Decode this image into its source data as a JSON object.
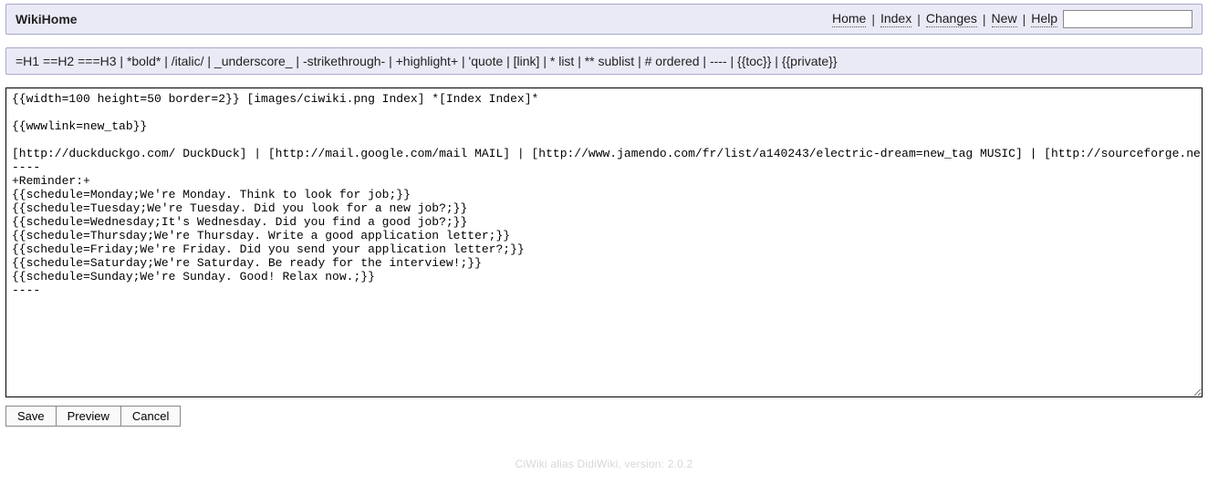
{
  "header": {
    "title": "WikiHome",
    "nav": {
      "home": "Home",
      "index": "Index",
      "changes": "Changes",
      "new": "New",
      "help": "Help"
    },
    "search_value": ""
  },
  "syntax_hint": "=H1 ==H2 ===H3 | *bold* | /italic/ | _underscore_ | -strikethrough- | +highlight+ | 'quote | [link] | * list | ** sublist | # ordered | ---- | {{toc}} | {{private}}",
  "editor_content": "{{width=100 height=50 border=2}} [images/ciwiki.png Index] *[Index Index]*\n\n{{wwwlink=new_tab}}\n\n[http://duckduckgo.com/ DuckDuck] | [http://mail.google.com/mail MAIL] | [http://www.jamendo.com/fr/list/a140243/electric-dream=new_tag MUSIC] | [http://sourceforge.net/ SourceForge]\n----\n+Reminder:+\n{{schedule=Monday;We're Monday. Think to look for job;}}\n{{schedule=Tuesday;We're Tuesday. Did you look for a new job?;}}\n{{schedule=Wednesday;It's Wednesday. Did you find a good job?;}}\n{{schedule=Thursday;We're Thursday. Write a good application letter;}}\n{{schedule=Friday;We're Friday. Did you send your application letter?;}}\n{{schedule=Saturday;We're Saturday. Be ready for the interview!;}}\n{{schedule=Sunday;We're Sunday. Good! Relax now.;}}\n----",
  "buttons": {
    "save": "Save",
    "preview": "Preview",
    "cancel": "Cancel"
  },
  "footer": "CiWiki alias DidiWiki, version: 2.0.2"
}
